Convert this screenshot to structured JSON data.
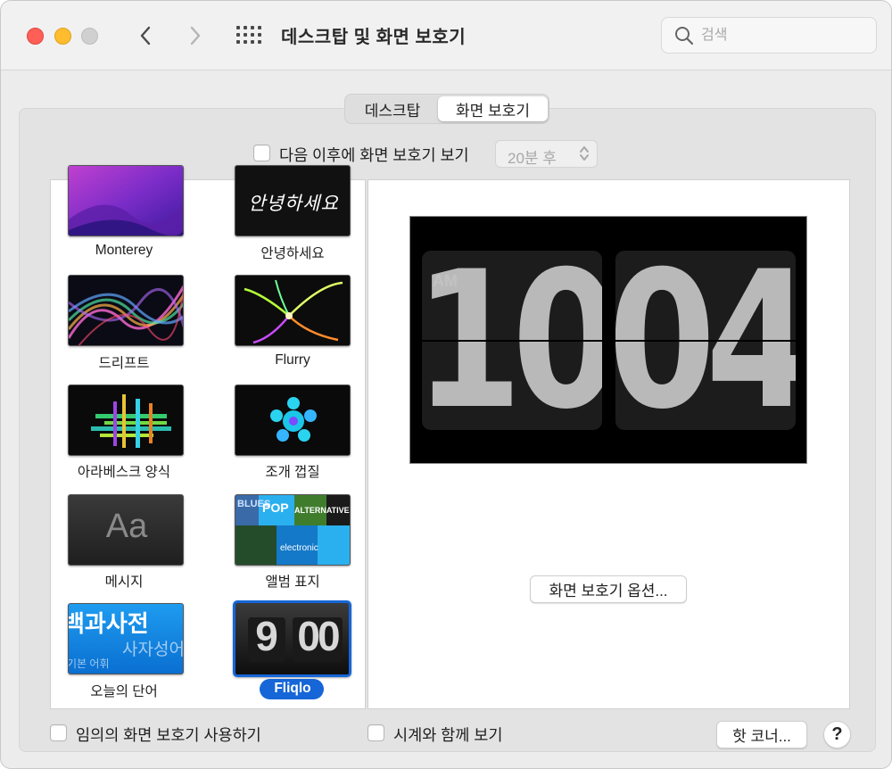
{
  "window": {
    "title": "데스크탑 및 화면 보호기"
  },
  "search": {
    "placeholder": "검색"
  },
  "tabs": [
    {
      "label": "데스크탑",
      "selected": false
    },
    {
      "label": "화면 보호기",
      "selected": true
    }
  ],
  "show_after": {
    "label": "다음 이후에 화면 보호기 보기",
    "checked": false,
    "value": "20분 후"
  },
  "screensavers": [
    {
      "label": "Monterey",
      "icon": "monterey-wallpaper",
      "selected": false
    },
    {
      "label": "안녕하세요",
      "icon": "hello-script",
      "thumb_text": "안녕하세요",
      "selected": false
    },
    {
      "label": "드리프트",
      "icon": "drift-waves",
      "selected": false
    },
    {
      "label": "Flurry",
      "icon": "flurry-streams",
      "selected": false
    },
    {
      "label": "아라베스크 양식",
      "icon": "arabesque-pattern",
      "selected": false
    },
    {
      "label": "조개 껍질",
      "icon": "shell-pattern",
      "selected": false
    },
    {
      "label": "메시지",
      "icon": "message-text",
      "thumb_text": "Aa",
      "selected": false
    },
    {
      "label": "앨범 표지",
      "icon": "album-artwork",
      "thumb_text": [
        "BLUES",
        "POP",
        "ALTERNATIVE",
        "electronic"
      ],
      "selected": false
    },
    {
      "label": "오늘의 단어",
      "icon": "word-of-the-day",
      "thumb_text": [
        "백과사전",
        "사자성어",
        "기본 어휘"
      ],
      "selected": false
    },
    {
      "label": "Fliqlo",
      "icon": "flip-clock",
      "thumb_text": [
        "9",
        "00"
      ],
      "selected": true
    }
  ],
  "preview": {
    "ampm": "AM",
    "hour": "10",
    "minute": "04"
  },
  "options_button": "화면 보호기 옵션...",
  "random": {
    "label": "임의의 화면 보호기 사용하기",
    "checked": false
  },
  "show_clock": {
    "label": "시계와 함께 보기",
    "checked": false
  },
  "hot_corners": "핫 코너...",
  "help": "?",
  "colors": {
    "accent": "#1666d8",
    "close": "#ff5f57",
    "minimize": "#febc2e"
  }
}
